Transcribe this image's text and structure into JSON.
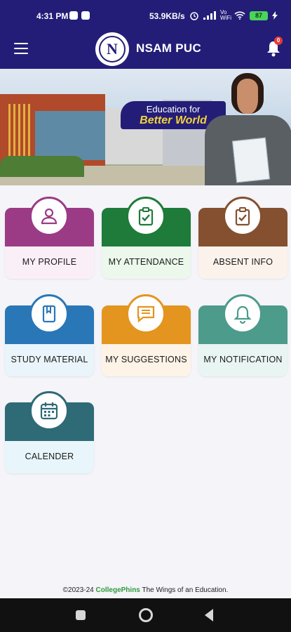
{
  "status_bar": {
    "time": "4:31 PM",
    "net_speed": "53.9KB/s",
    "network": "Vo WiFi",
    "battery": "87"
  },
  "app_bar": {
    "title": "NSAM PUC",
    "logo_letter": "N",
    "notification_count": "0"
  },
  "banner": {
    "line1": "Education for",
    "line2": "Better World"
  },
  "menu": {
    "tiles": [
      {
        "label": "MY PROFILE",
        "icon": "person-icon",
        "top_color": "#9b3b86",
        "bottom_color": "#fbeff7"
      },
      {
        "label": "MY ATTENDANCE",
        "icon": "clipboard-check-icon",
        "top_color": "#1e7b39",
        "bottom_color": "#ecf8ec"
      },
      {
        "label": "ABSENT INFO",
        "icon": "clipboard-check-icon",
        "top_color": "#845030",
        "bottom_color": "#fbf2ec"
      },
      {
        "label": "STUDY MATERIAL",
        "icon": "book-icon",
        "top_color": "#2a77b8",
        "bottom_color": "#eaf4fb"
      },
      {
        "label": "MY SUGGESTIONS",
        "icon": "chat-icon",
        "top_color": "#e3951f",
        "bottom_color": "#fdf3e6"
      },
      {
        "label": "MY NOTIFICATION",
        "icon": "bell-icon",
        "top_color": "#4c9b8b",
        "bottom_color": "#e9f5f2"
      },
      {
        "label": "CALENDER",
        "icon": "calendar-icon",
        "top_color": "#2f6a77",
        "bottom_color": "#e8f6fb"
      }
    ]
  },
  "footer": {
    "prefix": "©2023-24",
    "brand": "CollegePhins",
    "suffix": "The Wings of an Education."
  }
}
